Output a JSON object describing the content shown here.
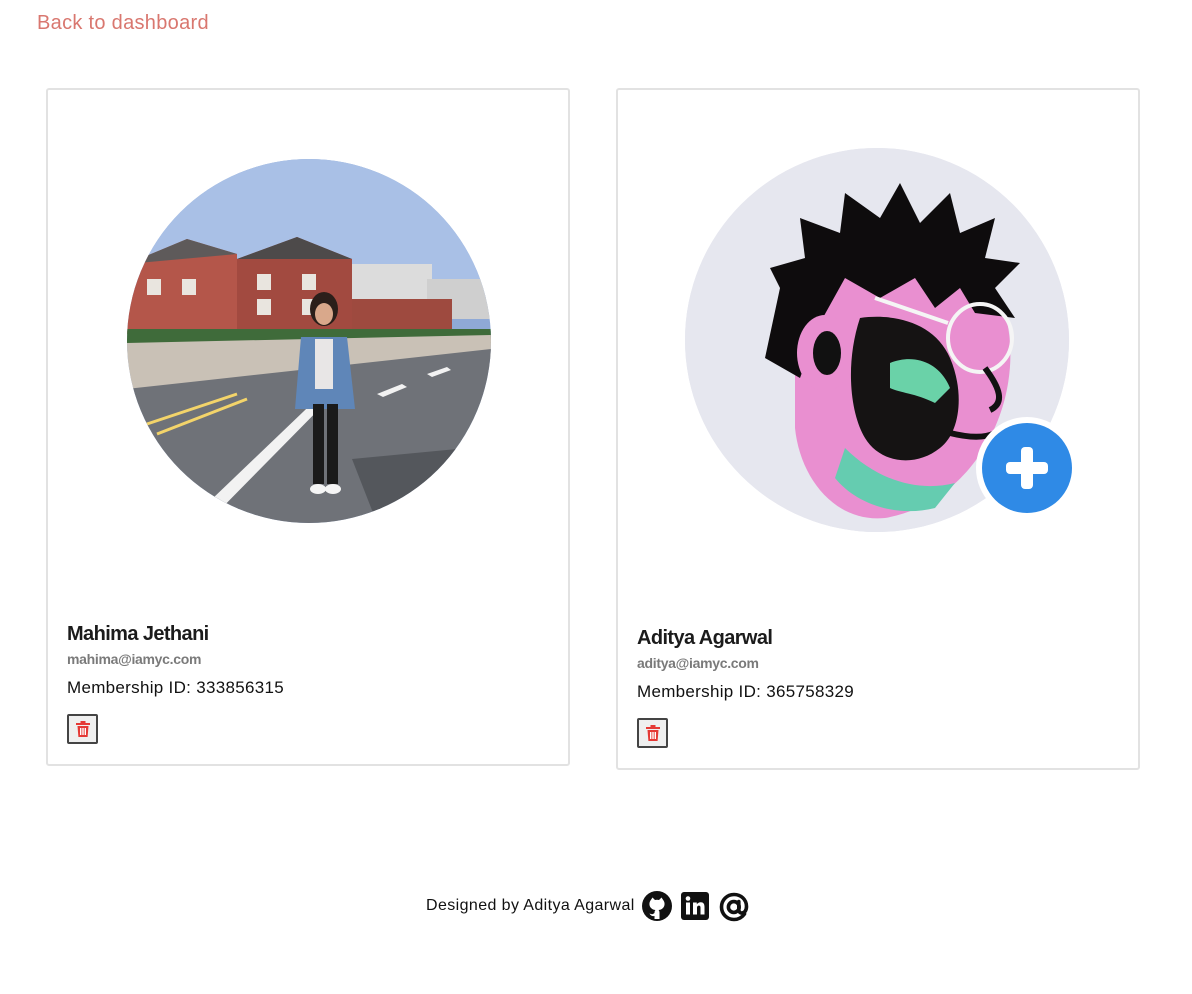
{
  "nav": {
    "back_label": "Back to dashboard"
  },
  "members": [
    {
      "name": "Mahima Jethani",
      "email": "mahima@iamyc.com",
      "membership": "Membership ID: 333856315"
    },
    {
      "name": "Aditya Agarwal",
      "email": "aditya@iamyc.com",
      "membership": "Membership ID: 365758329"
    }
  ],
  "footer": {
    "text": "Designed by Aditya Agarwal",
    "icons": [
      "github-icon",
      "linkedin-icon",
      "email-at-icon"
    ]
  },
  "colors": {
    "link": "#d9776f",
    "delete_icon": "#e53935",
    "add_button": "#2f8ae6",
    "card_border": "#e2e2e2"
  }
}
